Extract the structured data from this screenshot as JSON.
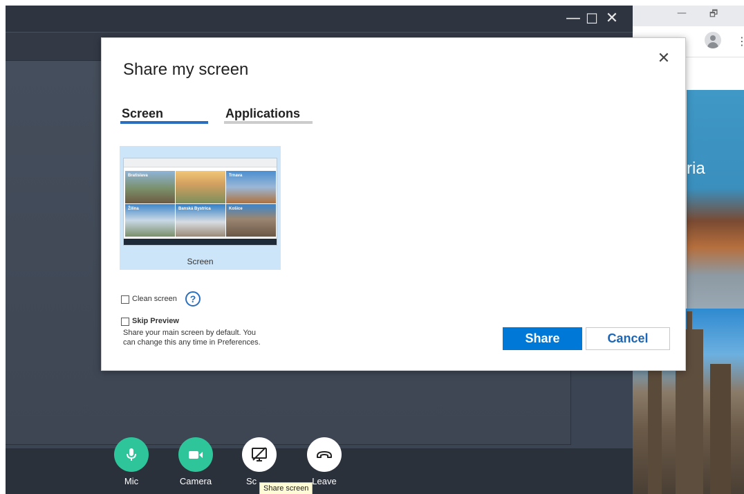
{
  "app_window": {
    "controls": {
      "minimize": "—",
      "maximize": "☐",
      "close": "✕"
    }
  },
  "controls_bar": {
    "mic_label": "Mic",
    "camera_label": "Camera",
    "screen_label": "Sc",
    "leave_label": "Leave",
    "tooltip": "Share screen",
    "colors": {
      "green": "#2ec59a",
      "white": "#ffffff",
      "bar": "#2b313b"
    },
    "icons": [
      "microphone-icon",
      "video-camera-icon",
      "share-screen-icon",
      "hang-up-icon"
    ]
  },
  "browser": {
    "controls": {
      "minimize": "—",
      "restore": "🗗"
    },
    "more": "⋮",
    "hero_text": "ria"
  },
  "dialog": {
    "title": "Share my screen",
    "close": "✕",
    "tabs": [
      {
        "label": "Screen",
        "selected": true,
        "underline_color": "#2a6ebd"
      },
      {
        "label": "Applications",
        "selected": false,
        "underline_color": "#cccccc"
      }
    ],
    "thumbnail": {
      "label": "Screen",
      "tiles": [
        "Bratislava",
        "",
        "Trnava",
        "Žilina",
        "Banská Bystrica",
        "Košice"
      ]
    },
    "clean_screen_label": "Clean screen",
    "help": "?",
    "skip_preview_label": "Skip Preview",
    "skip_preview_desc_line1": "Share your main screen by default. You",
    "skip_preview_desc_line2": "can change this any time in Preferences.",
    "share_button": "Share",
    "cancel_button": "Cancel",
    "colors": {
      "primary": "#0078d7",
      "cancel_text": "#1a66b8"
    }
  }
}
